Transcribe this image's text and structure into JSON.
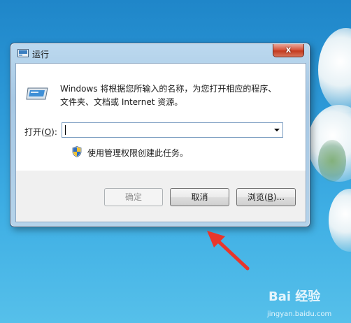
{
  "window": {
    "title": "运行",
    "close_label": "x"
  },
  "dialog": {
    "description_line1": "Windows 将根据您所输入的名称，为您打开相应的程序、",
    "description_line2": "文件夹、文档或 Internet 资源。",
    "open_label_prefix": "打开(",
    "open_label_key": "O",
    "open_label_suffix": "):",
    "open_value": "",
    "admin_text": "使用管理权限创建此任务。"
  },
  "buttons": {
    "ok": "确定",
    "cancel": "取消",
    "browse_prefix": "浏览(",
    "browse_key": "B",
    "browse_suffix": ")..."
  },
  "watermark": {
    "logo": "Bai 经验",
    "site": "jingyan.baidu.com"
  },
  "colors": {
    "desktop": "#2d9ad8",
    "annotation_arrow": "#e8362c"
  }
}
